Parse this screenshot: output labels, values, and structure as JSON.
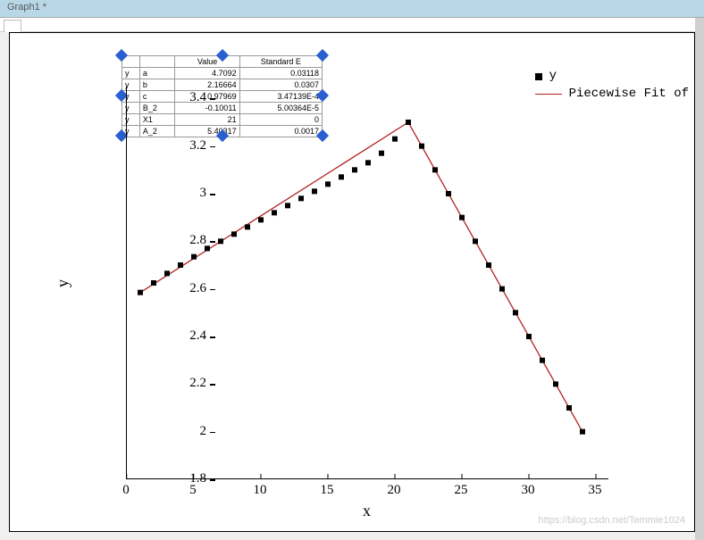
{
  "window": {
    "title": "Graph1 *"
  },
  "axes": {
    "xlabel": "x",
    "ylabel": "y",
    "xticks": [
      0,
      5,
      10,
      15,
      20,
      25,
      30,
      35
    ],
    "yticks": [
      1.8,
      2,
      2.2,
      2.4,
      2.6,
      2.8,
      3,
      3.2,
      3.4
    ]
  },
  "legend": {
    "items": [
      {
        "marker": "square",
        "label": "y"
      },
      {
        "marker": "line",
        "label": "Piecewise Fit of"
      }
    ]
  },
  "fit_table": {
    "headers": [
      "",
      "",
      "Value",
      "Standard E"
    ],
    "rows": [
      [
        "y",
        "a",
        "4.7092",
        "0.03118"
      ],
      [
        "y",
        "b",
        "2.16664",
        "0.0307"
      ],
      [
        "y",
        "c",
        "0.97969",
        "3.47139E-4"
      ],
      [
        "y",
        "B_2",
        "-0.10011",
        "5.00364E-5"
      ],
      [
        "y",
        "X1",
        "21",
        "0"
      ],
      [
        "y",
        "A_2",
        "5.40317",
        "0.0017"
      ]
    ]
  },
  "watermark": "https://blog.csdn.net/Temmie1024",
  "chart_data": {
    "type": "scatter+line",
    "title": "",
    "xlabel": "x",
    "ylabel": "y",
    "xlim": [
      0,
      36
    ],
    "ylim": [
      1.8,
      3.45
    ],
    "series": [
      {
        "name": "y",
        "style": "points",
        "x": [
          1,
          2,
          3,
          4,
          5,
          6,
          7,
          8,
          9,
          10,
          11,
          12,
          13,
          14,
          15,
          16,
          17,
          18,
          19,
          20,
          21,
          22,
          23,
          24,
          25,
          26,
          27,
          28,
          29,
          30,
          31,
          32,
          33,
          34
        ],
        "y": [
          2.585,
          2.625,
          2.665,
          2.7,
          2.735,
          2.77,
          2.8,
          2.83,
          2.86,
          2.89,
          2.92,
          2.95,
          2.98,
          3.01,
          3.04,
          3.07,
          3.1,
          3.13,
          3.17,
          3.23,
          3.3,
          3.2,
          3.1,
          3.0,
          2.9,
          2.8,
          2.7,
          2.6,
          2.5,
          2.4,
          2.3,
          2.2,
          2.1,
          2.0
        ]
      },
      {
        "name": "Piecewise Fit of",
        "style": "line",
        "x": [
          1,
          21,
          34
        ],
        "y": [
          2.585,
          3.3,
          2.0
        ]
      }
    ]
  }
}
